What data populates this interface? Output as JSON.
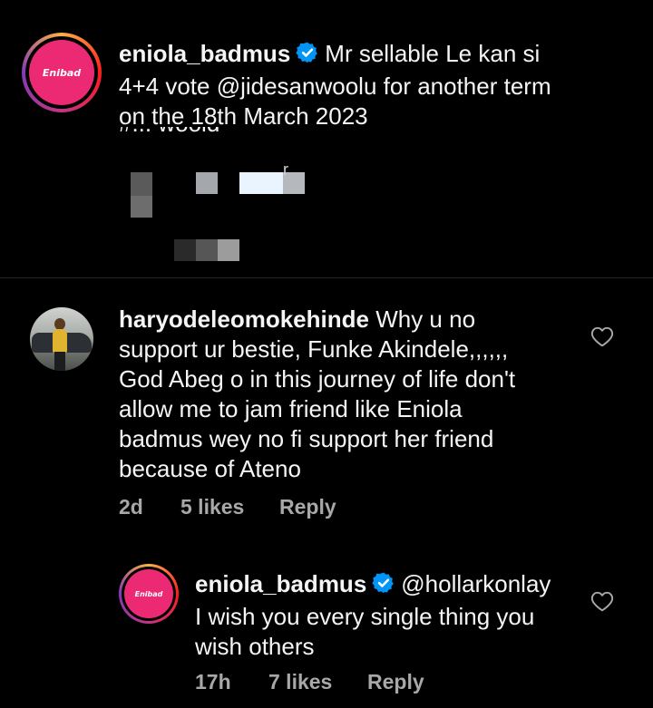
{
  "comments": [
    {
      "username": "eniola_badmus",
      "verified": true,
      "avatar_logo": "Enibad",
      "text_lines": [
        "Mr sellable Le kan si",
        "4+4 vote @jidesanwoolu for another term",
        "on the 18th March 2023"
      ],
      "cut_off_fragment": "#... woold",
      "blurred_fragment": "r"
    },
    {
      "username": "haryodeleomokehinde",
      "verified": false,
      "avatar_icon": "profile-photo",
      "text_first_line": "Why u no",
      "text_lines": [
        "support ur bestie, Funke Akindele,,,,,,",
        "God Abeg o in this journey of life don't",
        "allow me to jam friend like Eniola",
        "badmus wey no fi support her friend",
        "because of Ateno"
      ],
      "time": "2d",
      "likes": "5 likes",
      "reply_label": "Reply",
      "like_icon": "heart-outline-icon"
    },
    {
      "username": "eniola_badmus",
      "verified": true,
      "avatar_logo": "Enibad",
      "mention": "@hollarkonlay",
      "text_lines": [
        "I wish you every single thing you",
        "wish others"
      ],
      "time": "17h",
      "likes": "7 likes",
      "reply_label": "Reply",
      "like_icon": "heart-outline-icon"
    }
  ],
  "colors": {
    "background": "#000000",
    "text": "#f5f5f5",
    "meta": "#a8a8a8",
    "verified": "#0095f6",
    "brand": "#ec2a73"
  }
}
